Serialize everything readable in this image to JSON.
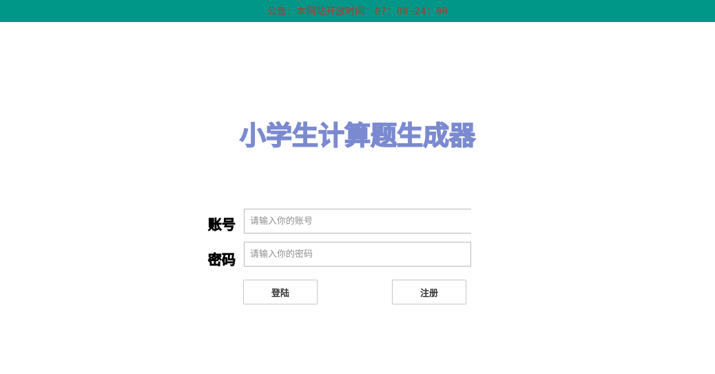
{
  "topbar": {
    "announcement": "公告：本网站开放时间：07：00~24：00",
    "bg_color": "#009688",
    "text_color": "#b03a2e"
  },
  "title": {
    "text": "小学生计算题生成器",
    "color": "#7b8ad0"
  },
  "form": {
    "username": {
      "label": "账号",
      "value": "",
      "placeholder": "请输入你的账号"
    },
    "password": {
      "label": "密码",
      "value": "",
      "placeholder": "请输入你的密码"
    }
  },
  "buttons": {
    "login": "登陆",
    "register": "注册"
  }
}
